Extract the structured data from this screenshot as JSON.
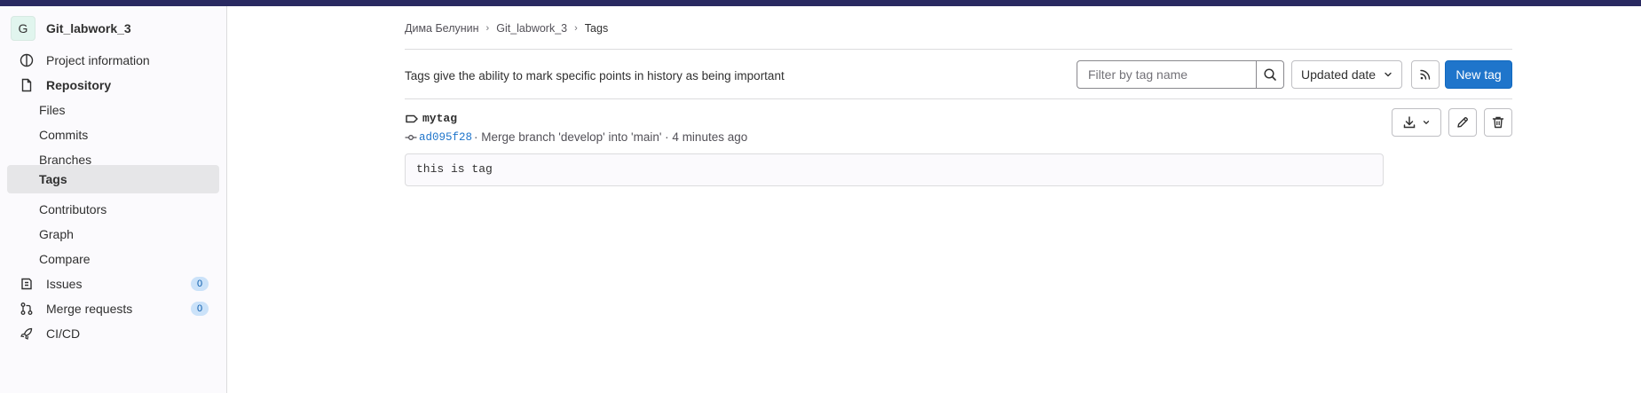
{
  "sidebar": {
    "project_avatar": "G",
    "project_name": "Git_labwork_3",
    "items": [
      {
        "label": "Project information",
        "icon": "info-icon"
      },
      {
        "label": "Repository",
        "icon": "document-icon"
      },
      {
        "label": "Files"
      },
      {
        "label": "Commits"
      },
      {
        "label": "Branches"
      },
      {
        "label": "Tags",
        "active": true
      },
      {
        "label": "Contributors"
      },
      {
        "label": "Graph"
      },
      {
        "label": "Compare"
      },
      {
        "label": "Issues",
        "icon": "issues-icon",
        "badge": "0"
      },
      {
        "label": "Merge requests",
        "icon": "merge-request-icon",
        "badge": "0"
      },
      {
        "label": "CI/CD",
        "icon": "rocket-icon"
      }
    ]
  },
  "breadcrumb": {
    "user": "Дима Белунин",
    "project": "Git_labwork_3",
    "current": "Tags"
  },
  "header": {
    "description": "Tags give the ability to mark specific points in history as being important",
    "search_placeholder": "Filter by tag name",
    "sort_label": "Updated date",
    "new_tag_label": "New tag"
  },
  "tag": {
    "name": "mytag",
    "commit_sha": "ad095f28",
    "commit_message": "· Merge branch 'develop' into 'main' · 4 minutes ago",
    "message": "this is tag"
  },
  "colors": {
    "topbar": "#292961",
    "primary": "#1f75cb",
    "link": "#1f75cb",
    "badge_bg": "#cbe2f9"
  }
}
